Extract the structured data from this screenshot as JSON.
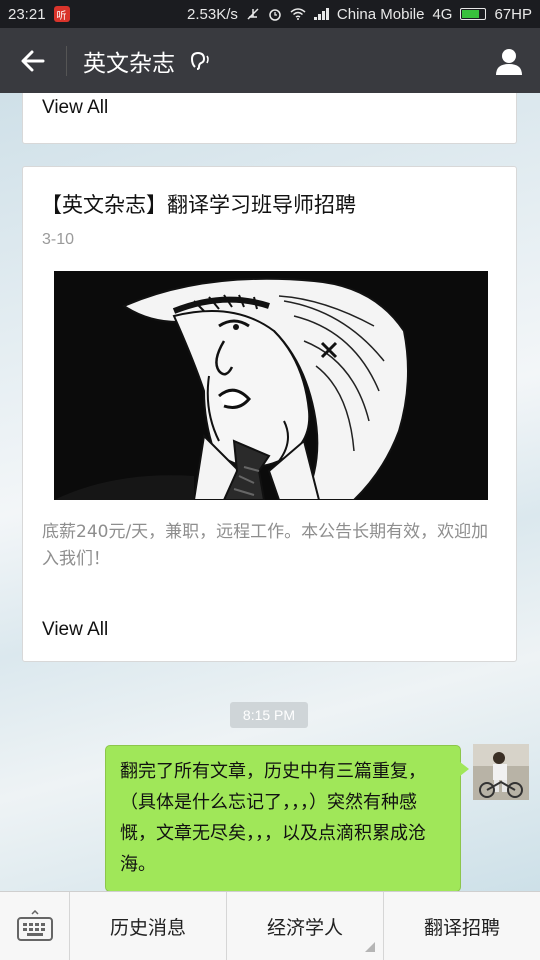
{
  "status_bar": {
    "time": "23:21",
    "notif_icon_text": "听",
    "speed": "2.53K/s",
    "carrier": "China Mobile",
    "network": "4G",
    "battery": "67HP",
    "battery_level": 0.67,
    "colors": {
      "battery_fill": "#39c13c"
    }
  },
  "header": {
    "title": "英文杂志",
    "back_icon": "arrow-left-icon",
    "ear_icon": "ear-icon",
    "profile_icon": "person-icon"
  },
  "feed": {
    "prev_view_all": "View All",
    "article": {
      "title": "【英文杂志】翻译学习班导师招聘",
      "date": "3-10",
      "summary": "底薪240元/天，兼职，远程工作。本公告长期有效，欢迎加入我们！",
      "view_all": "View All"
    }
  },
  "chat": {
    "timestamp": "8:15 PM",
    "message": "翻完了所有文章，历史中有三篇重复，（具体是什么忘记了，，，）突然有种感慨，文章无尽矣，，，以及点滴积累成沧海。",
    "bubble_color": "#a0e759"
  },
  "bottom_menu": {
    "keyboard_icon": "keyboard-icon",
    "items": [
      {
        "label": "历史消息"
      },
      {
        "label": "经济学人"
      },
      {
        "label": "翻译招聘"
      }
    ]
  }
}
